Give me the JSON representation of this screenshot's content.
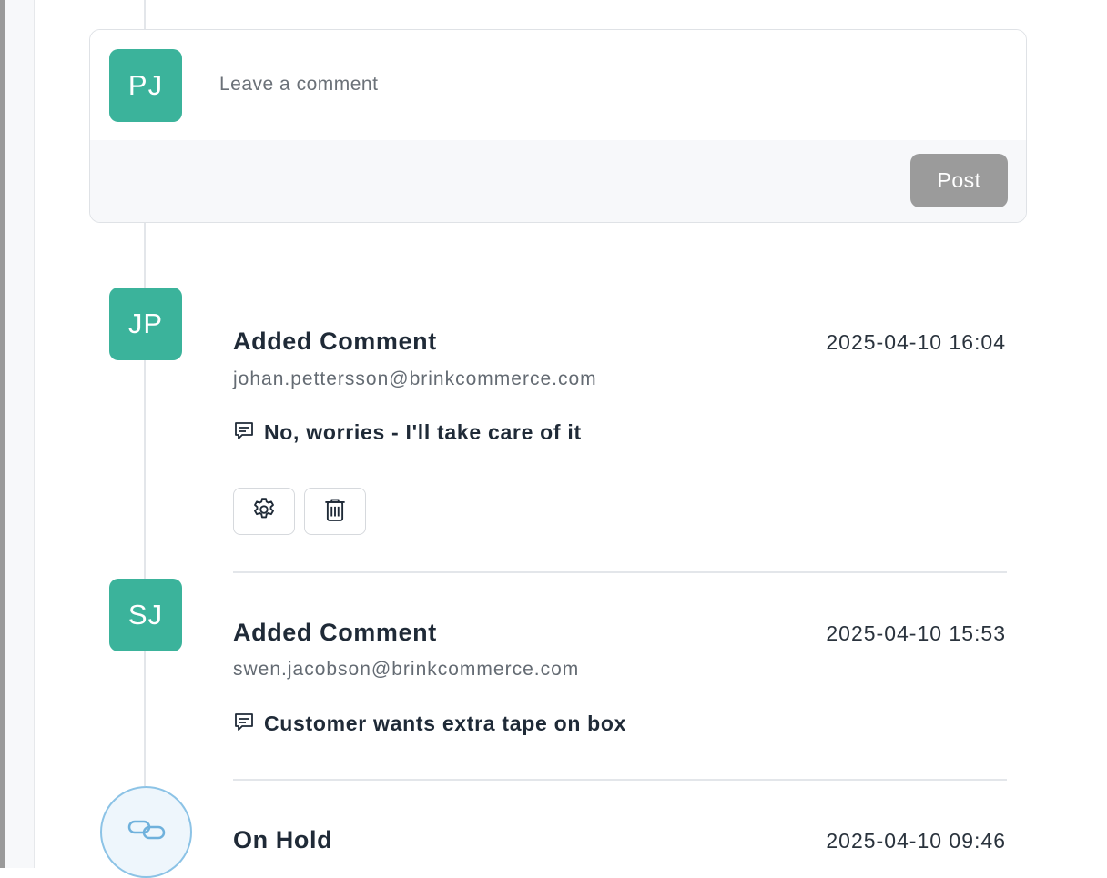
{
  "composer": {
    "avatar_initials": "PJ",
    "placeholder": "Leave a comment",
    "post_label": "Post"
  },
  "entries": [
    {
      "avatar_initials": "JP",
      "title": "Added Comment",
      "timestamp": "2025-04-10 16:04",
      "email": "johan.pettersson@brinkcommerce.com",
      "message": "No, worries - I'll take care of it",
      "actions": [
        "settings-icon",
        "trash-icon"
      ]
    },
    {
      "avatar_initials": "SJ",
      "title": "Added Comment",
      "timestamp": "2025-04-10 15:53",
      "email": "swen.jacobson@brinkcommerce.com",
      "message": "Customer wants extra tape on box"
    },
    {
      "avatar_icon": "link-icon",
      "title": "On Hold",
      "timestamp": "2025-04-10 09:46"
    }
  ],
  "colors": {
    "avatar_bg": "#3bb39b",
    "post_button_bg": "#9b9b9b",
    "status_circle_border": "#8cc3e6",
    "text_dark": "#1f2a37"
  }
}
